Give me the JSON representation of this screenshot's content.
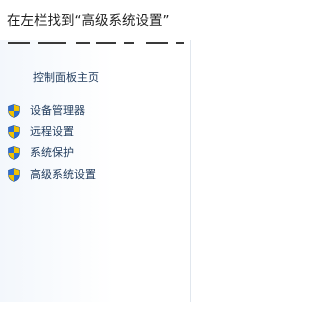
{
  "caption": "在左栏找到“高级系统设置”",
  "sidebar": {
    "home_link": "控制面板主页",
    "items": [
      {
        "label": "设备管理器",
        "icon": "uac-shield-icon"
      },
      {
        "label": "远程设置",
        "icon": "uac-shield-icon"
      },
      {
        "label": "系统保护",
        "icon": "uac-shield-icon"
      },
      {
        "label": "高级系统设置",
        "icon": "uac-shield-icon"
      }
    ]
  },
  "colors": {
    "link_text": "#1e395b",
    "shield_blue": "#2f6fd1",
    "shield_yellow": "#f2c200"
  }
}
